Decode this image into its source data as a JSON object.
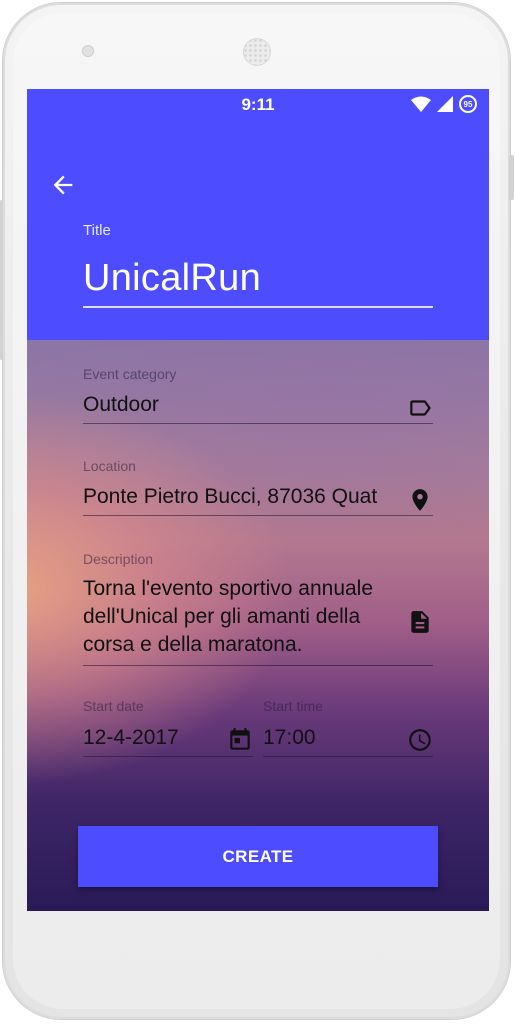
{
  "status_bar": {
    "time": "9:11",
    "battery_level": "95",
    "icons": [
      "wifi-icon",
      "cell-signal-icon",
      "battery-icon"
    ]
  },
  "app_bar": {
    "back_icon": "arrow-back-icon",
    "title_label": "Title",
    "title_value": "UnicalRun"
  },
  "form": {
    "category": {
      "label": "Event category",
      "value": "Outdoor",
      "icon": "label-tag-icon"
    },
    "location": {
      "label": "Location",
      "value": "Ponte Pietro Bucci, 87036 Quat",
      "icon": "location-pin-icon"
    },
    "description": {
      "label": "Description",
      "lines": [
        "Torna l'evento sportivo annuale",
        "dell'Unical per gli amanti della",
        "corsa e della maratona."
      ],
      "icon": "document-icon"
    },
    "start_date": {
      "label": "Start date",
      "value": "12-4-2017",
      "icon": "calendar-icon"
    },
    "start_time": {
      "label": "Start time",
      "value": "17:00",
      "icon": "clock-icon"
    }
  },
  "create_button": {
    "label": "CREATE"
  },
  "colors": {
    "primary": "#4d4dff",
    "text": "#111111",
    "on_primary": "#ffffff"
  }
}
